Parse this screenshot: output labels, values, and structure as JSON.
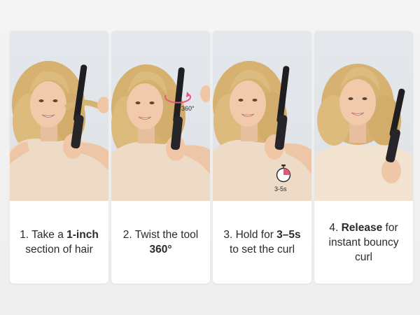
{
  "steps": [
    {
      "number": "1.",
      "pre": " Take a ",
      "bold": "1-inch",
      "post": " section of hair"
    },
    {
      "number": "2.",
      "pre": " Twist the tool ",
      "bold": "360°",
      "post": "",
      "overlay": "360°"
    },
    {
      "number": "3.",
      "pre": " Hold for ",
      "bold": "3–5s",
      "post": " to set the curl",
      "overlay": "3-5s"
    },
    {
      "number": "4.",
      "pre": " ",
      "bold": "Release",
      "post": " for instant bouncy curl"
    }
  ],
  "colors": {
    "accent": "#e9567a",
    "hair": "#d9b679",
    "skin": "#efc9aa",
    "top": "#efdcc8",
    "tool": "#1f1f22"
  }
}
